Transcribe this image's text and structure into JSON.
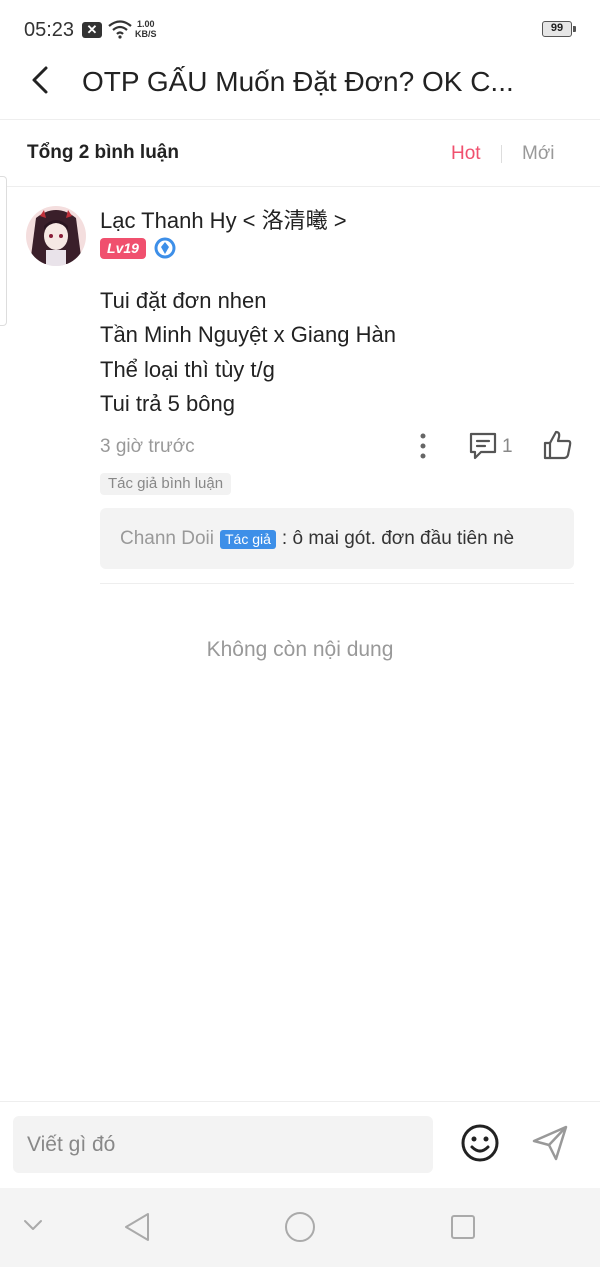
{
  "status_bar": {
    "time": "05:23",
    "notification_icon": "close-box-icon",
    "wifi_icon": "wifi-icon",
    "speed_value": "1.00",
    "speed_unit": "KB/S",
    "battery": "99"
  },
  "header": {
    "back_icon": "chevron-left-icon",
    "title": "OTP GẤU Muốn Đặt Đơn? OK C..."
  },
  "summary": {
    "total": "Tổng 2 bình luận",
    "sort_hot": "Hot",
    "sort_new": "Mới",
    "hot_color": "#f0506e"
  },
  "comment": {
    "username": "Lạc Thanh Hy < 洛清曦 >",
    "level": "Lv19",
    "level_color": "#f0506e",
    "verified_icon": "verified-badge-icon",
    "lines": [
      "Tui đặt đơn nhen",
      "Tần Minh Nguyệt x Giang Hàn",
      "Thể loại thì tùy t/g",
      "Tui trả 5 bông"
    ],
    "time": "3 giờ trước",
    "reply_count": "1",
    "tag": "Tác giả bình luận",
    "reply": {
      "author": "Chann Doii",
      "badge": "Tác giả",
      "badge_color": "#3d8fe8",
      "text": ": ô mai gót. đơn đầu tiên nè"
    }
  },
  "end_text": "Không còn nội dung",
  "input": {
    "placeholder": "Viết gì đó",
    "emoji_icon": "emoji-smile-icon",
    "send_icon": "send-icon"
  },
  "nav": {
    "icons": [
      "chevron-down-icon",
      "back-triangle-icon",
      "home-circle-icon",
      "recent-square-icon"
    ]
  }
}
